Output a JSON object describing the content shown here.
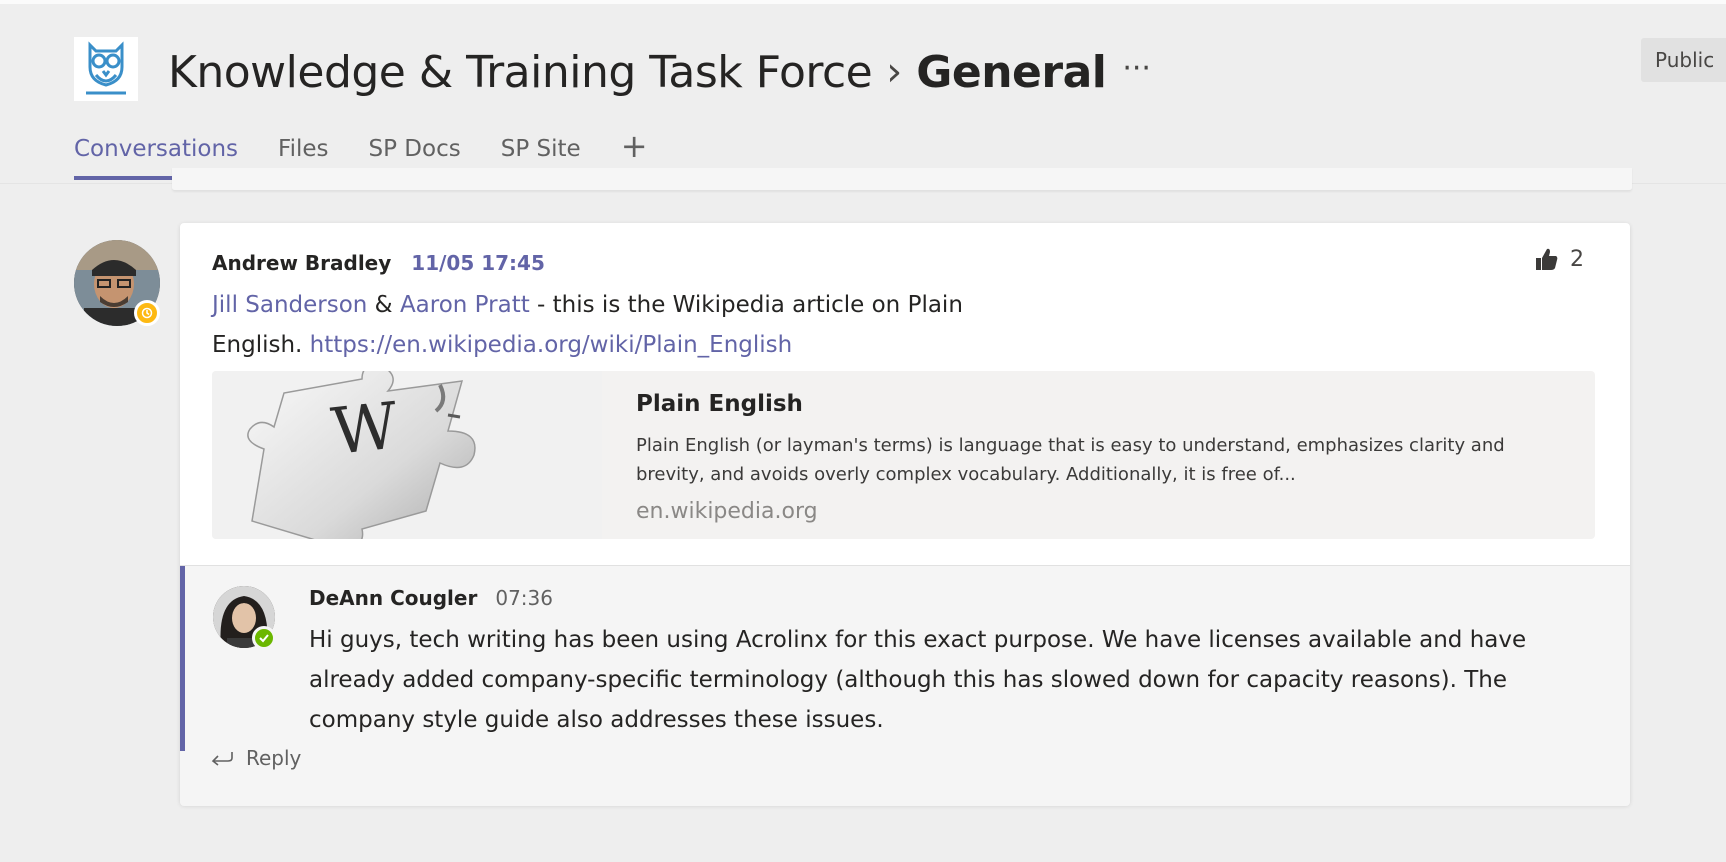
{
  "header": {
    "team_name": "Knowledge & Training Task Force",
    "separator": "›",
    "channel_name": "General",
    "more": "···",
    "visibility": "Public"
  },
  "tabs": [
    {
      "label": "Conversations",
      "active": true
    },
    {
      "label": "Files",
      "active": false
    },
    {
      "label": "SP Docs",
      "active": false
    },
    {
      "label": "SP Site",
      "active": false
    }
  ],
  "add_tab_label": "+",
  "post": {
    "author": "Andrew Bradley",
    "timestamp": "11/05 17:45",
    "author_status": "away",
    "like_count": "2",
    "mention_1": "Jill Sanderson",
    "and": " & ",
    "mention_2": "Aaron Pratt",
    "text_1": " - this is the Wikipedia article on Plain",
    "text_2": "English. ",
    "link": "https://en.wikipedia.org/wiki/Plain_English",
    "preview": {
      "title": "Plain English",
      "description": "Plain English (or layman's terms) is language that is easy to understand, emphasizes clarity and brevity, and avoids overly complex vocabulary. Additionally, it is free of...",
      "domain": "en.wikipedia.org",
      "logo_letter": "W"
    }
  },
  "reply": {
    "author": "DeAnn Cougler",
    "time": "07:36",
    "author_status": "available",
    "text": "Hi guys, tech writing has been using Acrolinx for this exact purpose. We have licenses available and have already added company-specific terminology (although this has slowed down for capacity reasons). The company style guide also addresses these issues."
  },
  "reply_action_label": "Reply",
  "colors": {
    "accent": "#6264a7",
    "away": "#fdb913",
    "available": "#6bb700",
    "background": "#eeeeee"
  }
}
